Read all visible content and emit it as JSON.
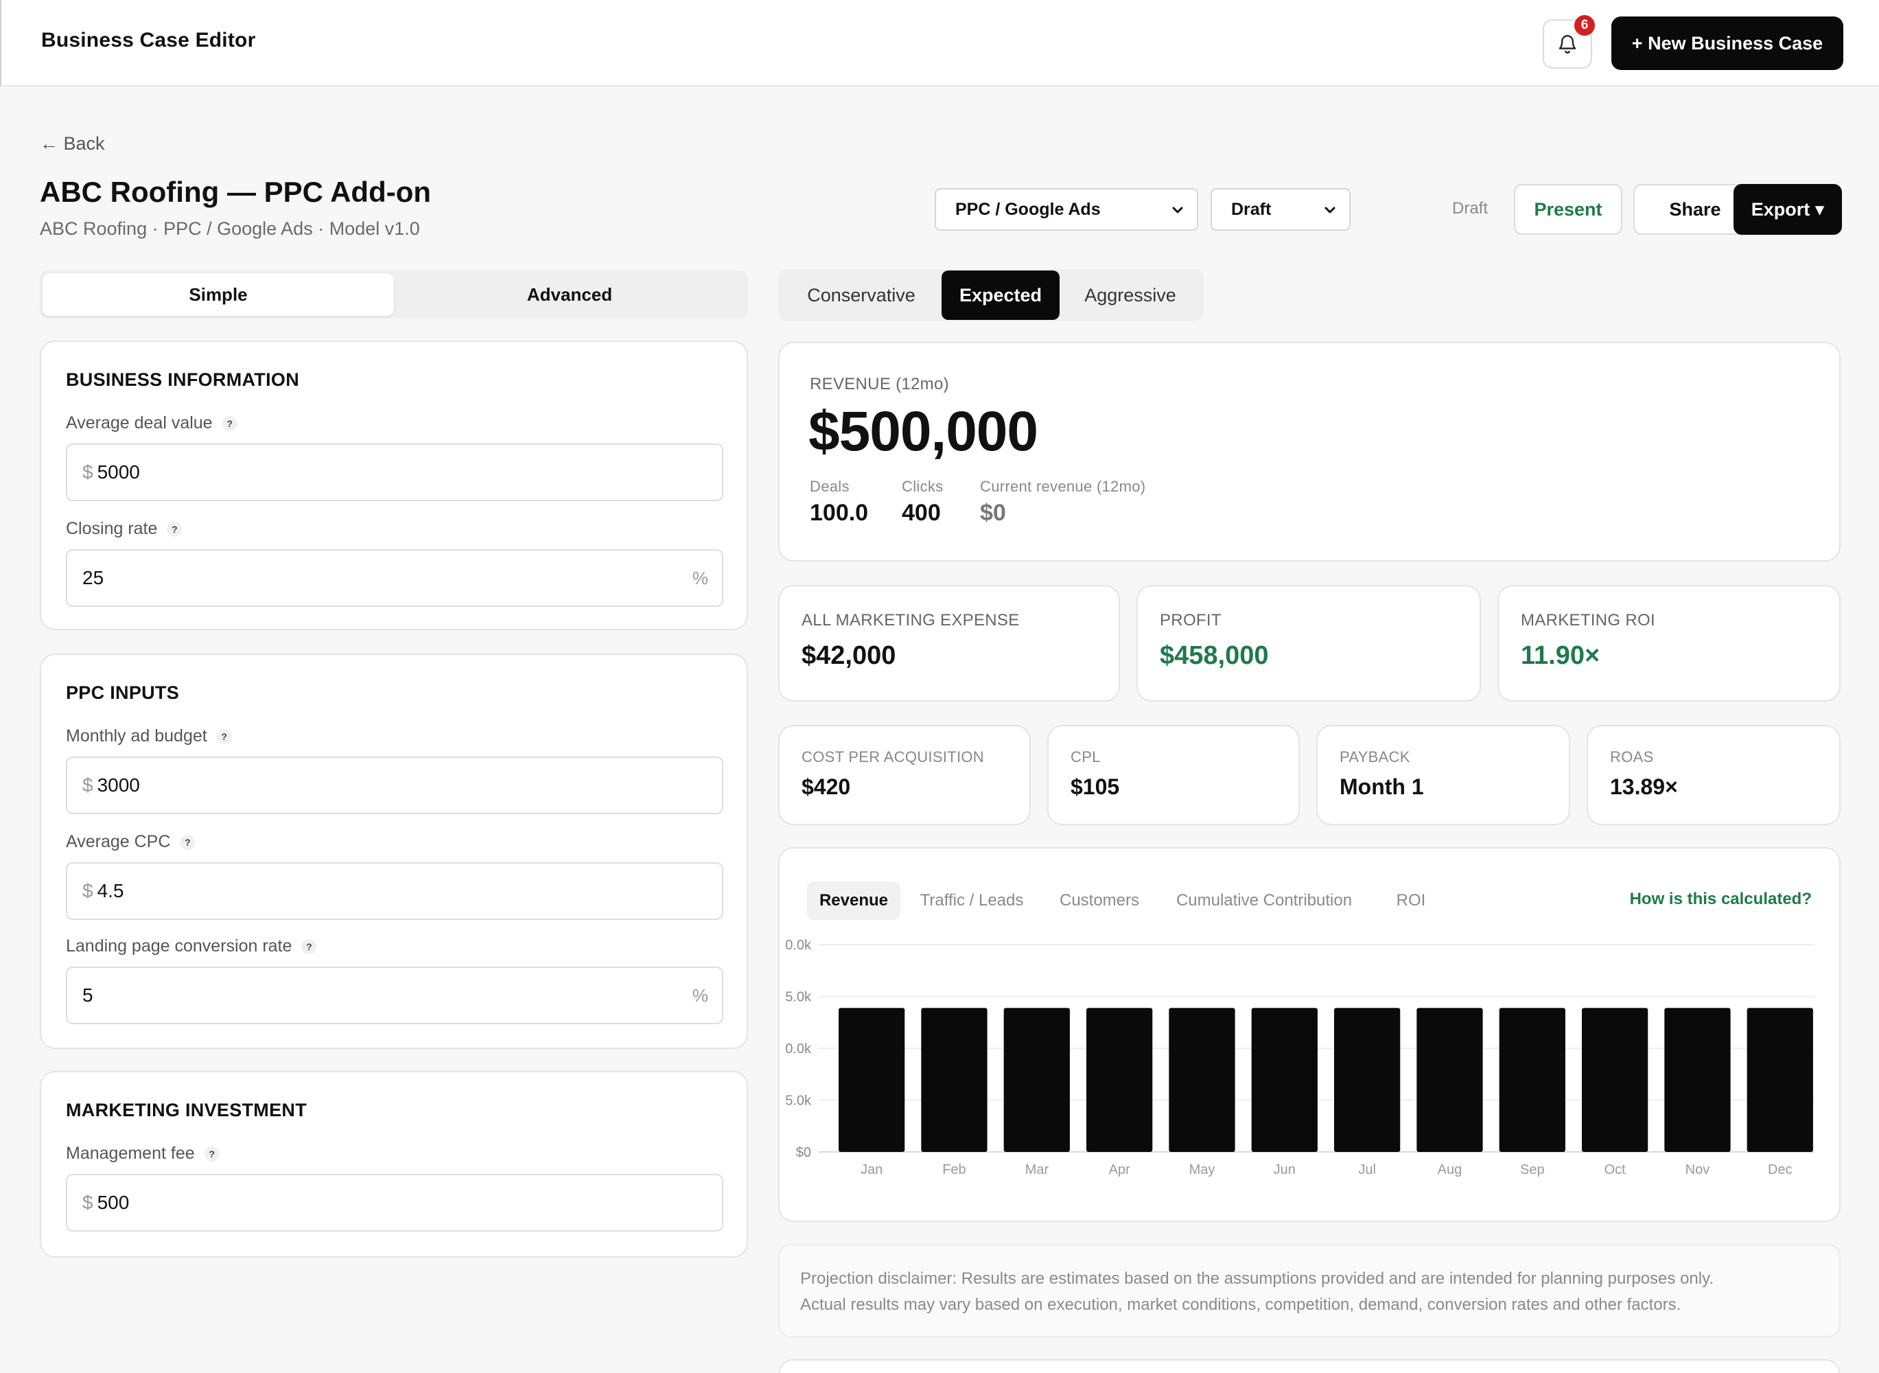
{
  "app": {
    "title": "Business Case Editor",
    "notifications_count": "6",
    "new_button": "+ New Business Case"
  },
  "header": {
    "back": "← Back",
    "title": "ABC Roofing — PPC Add-on",
    "subtitle": "ABC Roofing · PPC / Google Ads · Model v1.0",
    "channel_select": "PPC / Google Ads",
    "status_select": "Draft",
    "status_text": "Draft",
    "present": "Present",
    "share": "Share",
    "export": "Export ▾"
  },
  "mode_tabs": {
    "simple": "Simple",
    "advanced": "Advanced"
  },
  "scenario_tabs": {
    "conservative": "Conservative",
    "expected": "Expected",
    "aggressive": "Aggressive"
  },
  "business_info": {
    "title": "BUSINESS INFORMATION",
    "deal_label": "Average deal value",
    "deal_prefix": "$",
    "deal_value": "5000",
    "closing_label": "Closing rate",
    "closing_value": "25",
    "closing_suffix": "%"
  },
  "ppc_inputs": {
    "title": "PPC INPUTS",
    "budget_label": "Monthly ad budget",
    "budget_prefix": "$",
    "budget_value": "3000",
    "cpc_label": "Average CPC",
    "cpc_prefix": "$",
    "cpc_value": "4.5",
    "conv_label": "Landing page conversion rate",
    "conv_value": "5",
    "conv_suffix": "%"
  },
  "marketing_investment": {
    "title": "MARKETING INVESTMENT",
    "fee_label": "Management fee",
    "fee_prefix": "$",
    "fee_value": "500"
  },
  "revenue": {
    "label": "REVENUE (12mo)",
    "value": "$500,000",
    "deals_label": "Deals",
    "deals_value": "100.0",
    "clicks_label": "Clicks",
    "clicks_value": "400",
    "current_label": "Current revenue (12mo)",
    "current_value": "$0"
  },
  "kpis": {
    "expense_label": "ALL MARKETING EXPENSE",
    "expense_value": "$42,000",
    "profit_label": "PROFIT",
    "profit_value": "$458,000",
    "roi_label": "MARKETING ROI",
    "roi_value": "11.90×",
    "cpa_label": "COST PER ACQUISITION",
    "cpa_value": "$420",
    "cpl_label": "CPL",
    "cpl_value": "$105",
    "payback_label": "PAYBACK",
    "payback_value": "Month 1",
    "roas_label": "ROAS",
    "roas_value": "13.89×"
  },
  "chart_panel": {
    "tabs": [
      "Revenue",
      "Traffic / Leads",
      "Customers",
      "Cumulative Contribution",
      "ROI"
    ],
    "how_link": "How is this calculated?"
  },
  "chart_data": {
    "type": "bar",
    "categories": [
      "Jan",
      "Feb",
      "Mar",
      "Apr",
      "May",
      "Jun",
      "Jul",
      "Aug",
      "Sep",
      "Oct",
      "Nov",
      "Dec"
    ],
    "values": [
      41667,
      41667,
      41667,
      41667,
      41667,
      41667,
      41667,
      41667,
      41667,
      41667,
      41667,
      41667
    ],
    "yticks": [
      0,
      15000,
      30000,
      45000,
      60000
    ],
    "ytick_labels": [
      "$0",
      "5.0k",
      "0.0k",
      "5.0k",
      "0.0k"
    ],
    "ylim": [
      0,
      60000
    ],
    "bar_color": "#0a0a0a",
    "grid": true
  },
  "disclaimer": {
    "line1": "Projection disclaimer: Results are estimates based on the assumptions provided and are intended for planning purposes only.",
    "line2": "Actual results may vary based on execution, market conditions, competition, demand, conversion rates and other factors."
  }
}
